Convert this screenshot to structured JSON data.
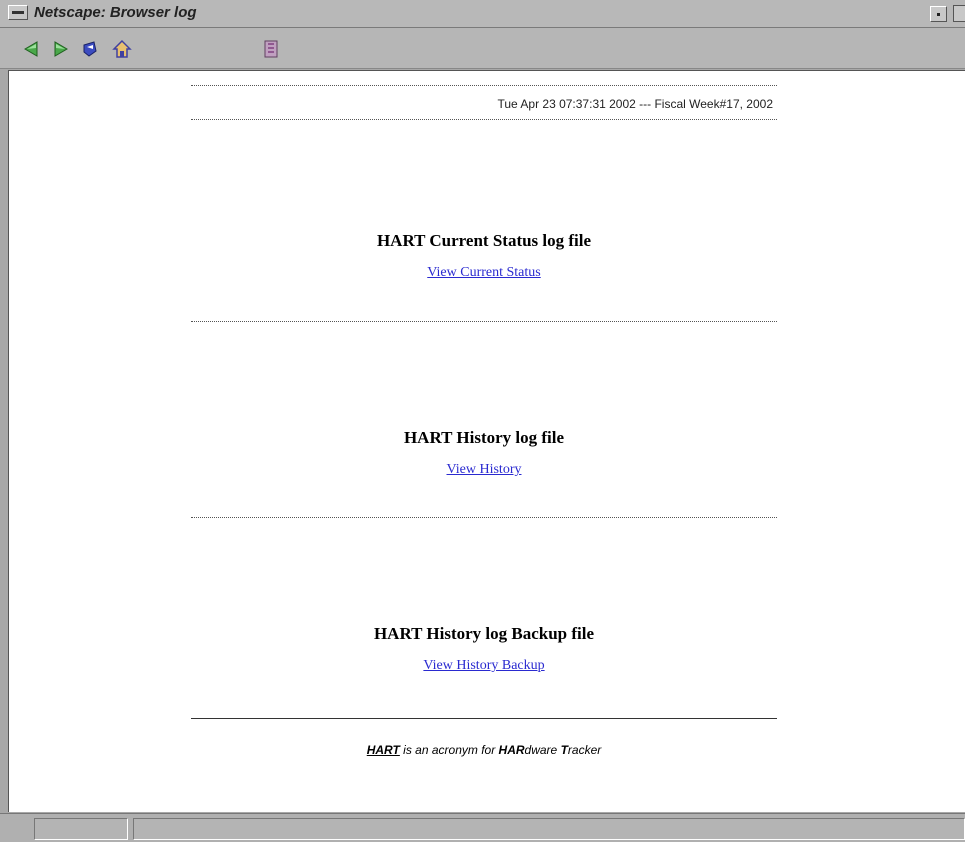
{
  "window": {
    "title": "Netscape: Browser log"
  },
  "toolbar": {
    "icons": [
      "back-icon",
      "forward-icon",
      "reload-icon",
      "home-icon",
      "stop-icon"
    ]
  },
  "page": {
    "datestamp": "Tue Apr 23 07:37:31 2002 --- Fiscal Week#17, 2002",
    "sections": [
      {
        "heading": "HART Current Status log file",
        "link": "View Current Status"
      },
      {
        "heading": "HART History log file",
        "link": "View History"
      },
      {
        "heading": "HART History log Backup file",
        "link": "View History Backup"
      }
    ],
    "footer": {
      "hart": "HART",
      "text1": " is an acronym for ",
      "har": "HAR",
      "text2": "dware ",
      "t": "T",
      "text3": "racker"
    }
  },
  "colors": {
    "link": "#2a2ad0",
    "chrome": "#b8b8b8"
  }
}
